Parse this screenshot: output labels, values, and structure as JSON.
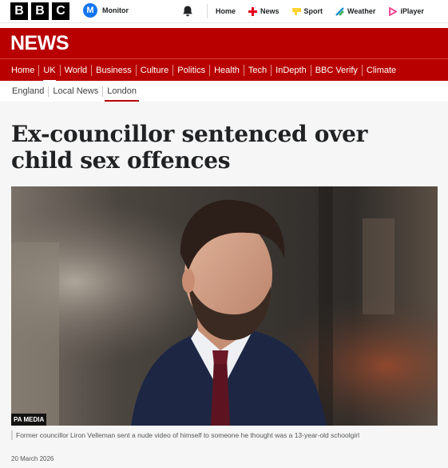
{
  "header": {
    "logo_letters": [
      "B",
      "B",
      "C"
    ],
    "account": {
      "avatar_letter": "M",
      "label": "Monitor"
    },
    "nav": [
      {
        "label": "Home",
        "icon": "home"
      },
      {
        "label": "News",
        "icon": "news-icon",
        "color": "#e0001b"
      },
      {
        "label": "Sport",
        "icon": "sport-icon",
        "color": "#ffd230"
      },
      {
        "label": "Weather",
        "icon": "weather-icon",
        "color": "#1e90c8"
      },
      {
        "label": "iPlayer",
        "icon": "iplayer-icon",
        "color": "#f54997"
      }
    ]
  },
  "news_banner": {
    "title": "NEWS",
    "color": "#b80000"
  },
  "primary_nav": [
    "Home",
    "UK",
    "World",
    "Business",
    "Culture",
    "Politics",
    "Health",
    "Tech",
    "InDepth",
    "BBC Verify",
    "Climate"
  ],
  "primary_nav_active": "UK",
  "secondary_nav": [
    "England",
    "Local News",
    "London"
  ],
  "secondary_nav_active": "London",
  "article": {
    "headline": "Ex-councillor sentenced over child sex offences",
    "image_credit": "PA MEDIA",
    "caption": "Former councillor Liron Velleman sent a nude video of himself to someone he thought was a 13-year-old schoolgirl",
    "date": "20 March 2026"
  }
}
